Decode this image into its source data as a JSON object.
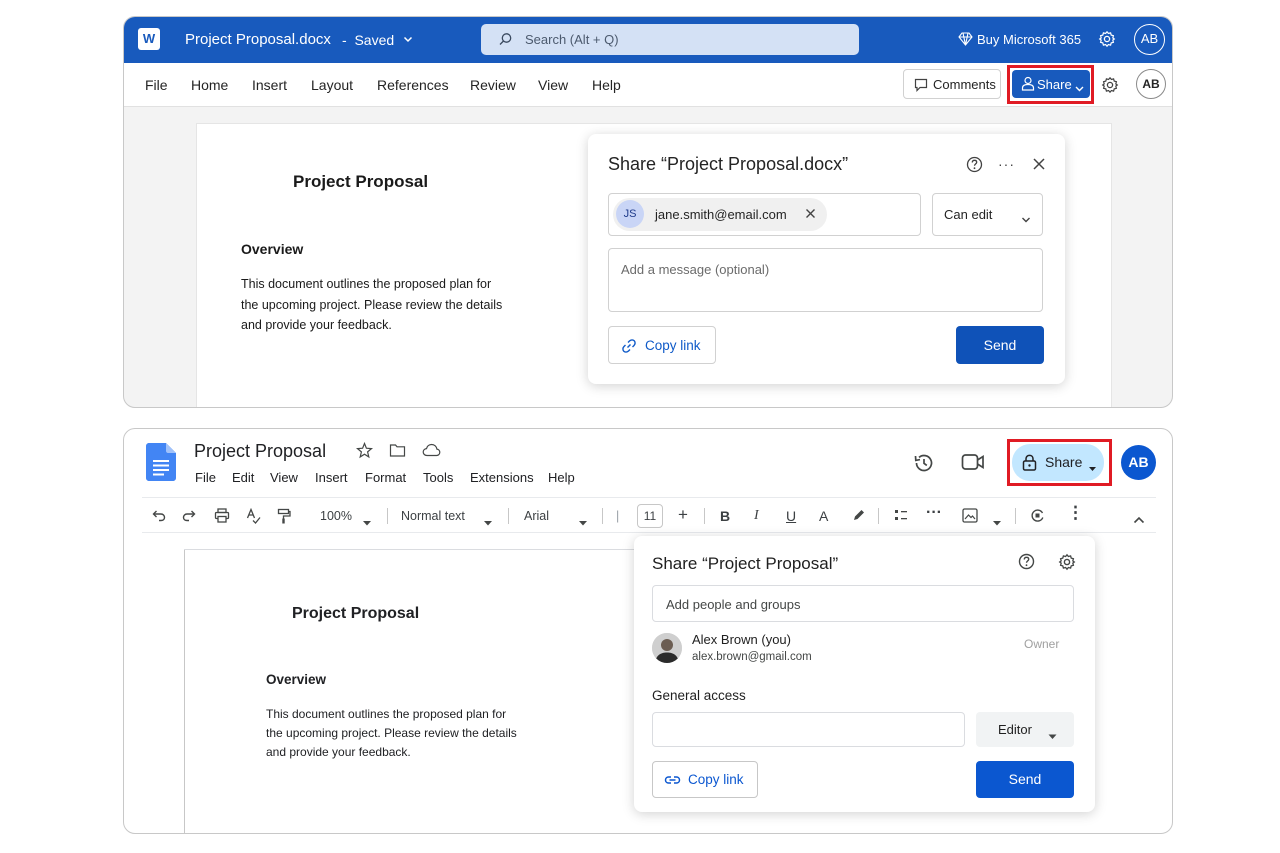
{
  "word": {
    "app_icon_letter": "W",
    "doc_title": "Project Proposal.docx",
    "separator": "-",
    "save_status": "Saved",
    "search_placeholder": "Search (Alt + Q)",
    "buy_label": "Buy Microsoft 365",
    "avatar_initials": "AB",
    "menu": [
      "File",
      "Home",
      "Insert",
      "Layout",
      "References",
      "Review",
      "View",
      "Help"
    ],
    "comments_label": "Comments",
    "share_label": "Share",
    "document": {
      "heading": "Project Proposal",
      "subheading": "Overview",
      "paragraph": "This document outlines the proposed plan for the upcoming project. Please review the details and provide your feedback."
    },
    "share_dialog": {
      "title": "Share “Project Proposal.docx”",
      "more_label": "···",
      "recipient_initials": "JS",
      "recipient_email": "jane.smith@email.com",
      "permission": "Can edit",
      "message_placeholder": "Add a message (optional)",
      "copy_link_label": "Copy link",
      "send_label": "Send"
    },
    "colors": {
      "brand": "#185abd",
      "highlight": "#e01b24"
    }
  },
  "gdocs": {
    "doc_title": "Project Proposal",
    "menu": [
      "File",
      "Edit",
      "View",
      "Insert",
      "Format",
      "Tools",
      "Extensions",
      "Help"
    ],
    "share_label": "Share",
    "avatar_initials": "AB",
    "toolbar": {
      "zoom": "100%",
      "style": "Normal text",
      "font": "Arial",
      "font_size": "11",
      "bold": "B",
      "italic": "I",
      "underline": "U",
      "text_color": "A",
      "minus": "|",
      "plus": "+"
    },
    "document": {
      "heading": "Project Proposal",
      "subheading": "Overview",
      "paragraph": "This document outlines the proposed plan for the upcoming project. Please review the details and provide your feedback."
    },
    "share_dialog": {
      "title": "Share “Project Proposal”",
      "add_placeholder": "Add people and groups",
      "person_name": "Alex Brown (you)",
      "person_email": "alex.brown@gmail.com",
      "person_role": "Owner",
      "general_access_label": "General access",
      "role": "Editor",
      "copy_link_label": "Copy link",
      "send_label": "Send"
    },
    "colors": {
      "brand": "#0b57d0",
      "share_bg": "#c2e7ff",
      "highlight": "#e01b24"
    }
  }
}
